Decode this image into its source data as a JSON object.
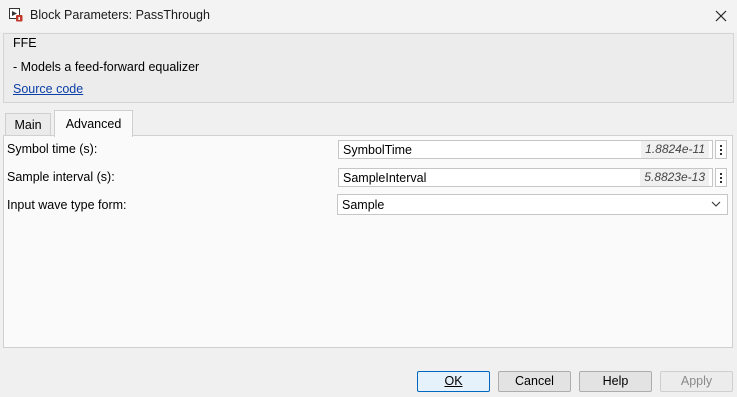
{
  "window": {
    "title": "Block Parameters: PassThrough"
  },
  "panel": {
    "title": "FFE",
    "description": "- Models a feed-forward equalizer",
    "link": "Source code"
  },
  "tabs": [
    {
      "label": "Main",
      "selected": false
    },
    {
      "label": "Advanced",
      "selected": true
    }
  ],
  "params": {
    "symbol_time": {
      "label": "Symbol time (s):",
      "value": "SymbolTime",
      "evaluated": "1.8824e-11"
    },
    "sample_interval": {
      "label": "Sample interval (s):",
      "value": "SampleInterval",
      "evaluated": "5.8823e-13"
    },
    "wave_type": {
      "label": "Input wave type form:",
      "selected": "Sample"
    }
  },
  "buttons": {
    "ok": "OK",
    "cancel": "Cancel",
    "help": "Help",
    "apply": "Apply"
  },
  "icons": {
    "app": "block-params-icon",
    "close": "close-icon",
    "more": "more-options-icon",
    "dropdown": "chevron-down-icon"
  }
}
